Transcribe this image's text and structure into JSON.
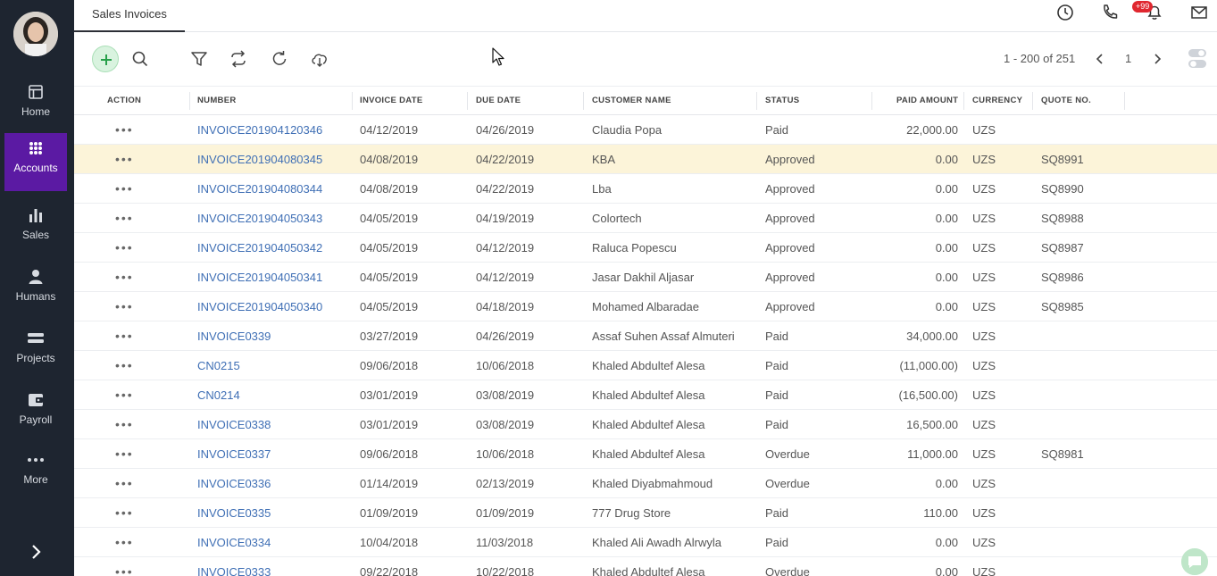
{
  "sidebar": {
    "items": [
      {
        "label": "Home",
        "icon": "layout-icon"
      },
      {
        "label": "Accounts",
        "icon": "grid-icon",
        "active": true
      },
      {
        "label": "Sales",
        "icon": "bar-chart-icon"
      },
      {
        "label": "Humans",
        "icon": "person-icon"
      },
      {
        "label": "Projects",
        "icon": "projects-icon"
      },
      {
        "label": "Payroll",
        "icon": "wallet-icon"
      },
      {
        "label": "More",
        "icon": "more-dots-icon"
      }
    ],
    "active_color": "#5b1aa3"
  },
  "header": {
    "tab_label": "Sales Invoices",
    "notification_badge": "+99"
  },
  "toolbar": {
    "pager_text": "1 - 200 of 251",
    "page_number": "1"
  },
  "table": {
    "columns": [
      "ACTION",
      "NUMBER",
      "INVOICE DATE",
      "DUE DATE",
      "CUSTOMER NAME",
      "STATUS",
      "PAID AMOUNT",
      "CURRENCY",
      "QUOTE NO."
    ],
    "rows": [
      {
        "number": "INVOICE201904120346",
        "invoice_date": "04/12/2019",
        "due_date": "04/26/2019",
        "customer": "Claudia Popa",
        "status": "Paid",
        "paid": "22,000.00",
        "currency": "UZS",
        "quote": ""
      },
      {
        "number": "INVOICE201904080345",
        "invoice_date": "04/08/2019",
        "due_date": "04/22/2019",
        "customer": "KBA",
        "status": "Approved",
        "paid": "0.00",
        "currency": "UZS",
        "quote": "SQ8991"
      },
      {
        "number": "INVOICE201904080344",
        "invoice_date": "04/08/2019",
        "due_date": "04/22/2019",
        "customer": "Lba",
        "status": "Approved",
        "paid": "0.00",
        "currency": "UZS",
        "quote": "SQ8990"
      },
      {
        "number": "INVOICE201904050343",
        "invoice_date": "04/05/2019",
        "due_date": "04/19/2019",
        "customer": "Colortech",
        "status": "Approved",
        "paid": "0.00",
        "currency": "UZS",
        "quote": "SQ8988"
      },
      {
        "number": "INVOICE201904050342",
        "invoice_date": "04/05/2019",
        "due_date": "04/12/2019",
        "customer": "Raluca Popescu",
        "status": "Approved",
        "paid": "0.00",
        "currency": "UZS",
        "quote": "SQ8987"
      },
      {
        "number": "INVOICE201904050341",
        "invoice_date": "04/05/2019",
        "due_date": "04/12/2019",
        "customer": "Jasar Dakhil Aljasar",
        "status": "Approved",
        "paid": "0.00",
        "currency": "UZS",
        "quote": "SQ8986"
      },
      {
        "number": "INVOICE201904050340",
        "invoice_date": "04/05/2019",
        "due_date": "04/18/2019",
        "customer": "Mohamed Albaradae",
        "status": "Approved",
        "paid": "0.00",
        "currency": "UZS",
        "quote": "SQ8985"
      },
      {
        "number": "INVOICE0339",
        "invoice_date": "03/27/2019",
        "due_date": "04/26/2019",
        "customer": "Assaf Suhen Assaf Almuteri",
        "status": "Paid",
        "paid": "34,000.00",
        "currency": "UZS",
        "quote": ""
      },
      {
        "number": "CN0215",
        "invoice_date": "09/06/2018",
        "due_date": "10/06/2018",
        "customer": "Khaled Abdultef Alesa",
        "status": "Paid",
        "paid": "(11,000.00)",
        "currency": "UZS",
        "quote": ""
      },
      {
        "number": "CN0214",
        "invoice_date": "03/01/2019",
        "due_date": "03/08/2019",
        "customer": "Khaled Abdultef Alesa",
        "status": "Paid",
        "paid": "(16,500.00)",
        "currency": "UZS",
        "quote": ""
      },
      {
        "number": "INVOICE0338",
        "invoice_date": "03/01/2019",
        "due_date": "03/08/2019",
        "customer": "Khaled Abdultef Alesa",
        "status": "Paid",
        "paid": "16,500.00",
        "currency": "UZS",
        "quote": ""
      },
      {
        "number": "INVOICE0337",
        "invoice_date": "09/06/2018",
        "due_date": "10/06/2018",
        "customer": "Khaled Abdultef Alesa",
        "status": "Overdue",
        "paid": "11,000.00",
        "currency": "UZS",
        "quote": "SQ8981"
      },
      {
        "number": "INVOICE0336",
        "invoice_date": "01/14/2019",
        "due_date": "02/13/2019",
        "customer": "Khaled Diyabmahmoud",
        "status": "Overdue",
        "paid": "0.00",
        "currency": "UZS",
        "quote": ""
      },
      {
        "number": "INVOICE0335",
        "invoice_date": "01/09/2019",
        "due_date": "01/09/2019",
        "customer": "777 Drug Store",
        "status": "Paid",
        "paid": "110.00",
        "currency": "UZS",
        "quote": ""
      },
      {
        "number": "INVOICE0334",
        "invoice_date": "10/04/2018",
        "due_date": "11/03/2018",
        "customer": "Khaled Ali Awadh Alrwyla",
        "status": "Paid",
        "paid": "0.00",
        "currency": "UZS",
        "quote": ""
      },
      {
        "number": "INVOICE0333",
        "invoice_date": "09/22/2018",
        "due_date": "10/22/2018",
        "customer": "Khaled Abdultef Alesa",
        "status": "Overdue",
        "paid": "0.00",
        "currency": "UZS",
        "quote": ""
      }
    ],
    "highlighted_row": 1,
    "highlight_color": "#fcf4d9",
    "link_color": "#3f6fb5"
  }
}
